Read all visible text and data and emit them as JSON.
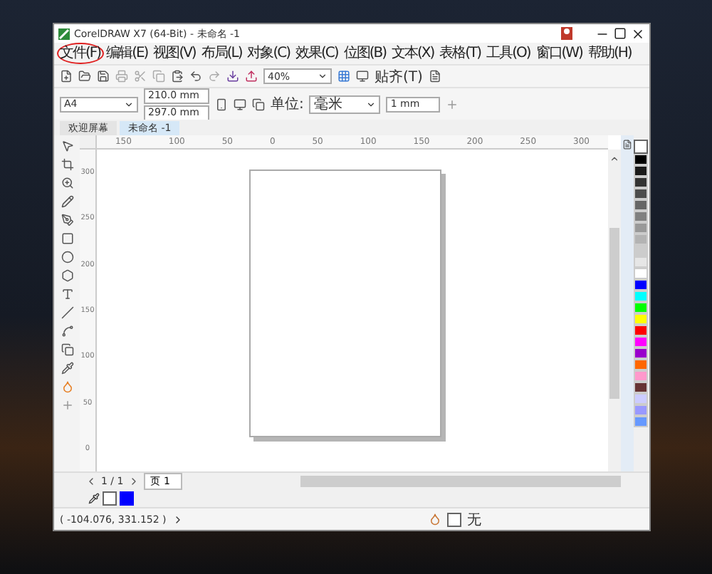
{
  "window": {
    "title": "CorelDRAW X7 (64-Bit) - 未命名 -1"
  },
  "menu": [
    {
      "label": "文件(F)",
      "circled": true
    },
    {
      "label": "编辑(E)",
      "circled": false
    },
    {
      "label": "视图(V)",
      "circled": false
    },
    {
      "label": "布局(L)",
      "circled": false
    },
    {
      "label": "对象(C)",
      "circled": false
    },
    {
      "label": "效果(C)",
      "circled": false
    },
    {
      "label": "位图(B)",
      "circled": false
    },
    {
      "label": "文本(X)",
      "circled": false
    },
    {
      "label": "表格(T)",
      "circled": false
    },
    {
      "label": "工具(O)",
      "circled": false
    },
    {
      "label": "窗口(W)",
      "circled": false
    },
    {
      "label": "帮助(H)",
      "circled": false
    }
  ],
  "toolbar": {
    "zoom": "40%",
    "snap": "贴齐(T)"
  },
  "property_bar": {
    "page_size": "A4",
    "width": "210.0 mm",
    "height": "297.0 mm",
    "units_label": "单位:",
    "units": "毫米",
    "nudge": "1 mm"
  },
  "doc_tabs": [
    {
      "label": "欢迎屏幕",
      "selected": false
    },
    {
      "label": "未命名 -1",
      "selected": true
    }
  ],
  "rulers": {
    "horizontal": [
      "150",
      "100",
      "50",
      "0",
      "50",
      "100",
      "150",
      "200",
      "250",
      "300"
    ],
    "vertical": [
      "300",
      "250",
      "200",
      "150",
      "100",
      "50",
      "0"
    ]
  },
  "page_nav": {
    "count": "1 / 1",
    "page_tab": "页 1"
  },
  "palette": [
    {
      "color": "#000000"
    },
    {
      "color": "#1a1a1a"
    },
    {
      "color": "#333333"
    },
    {
      "color": "#4d4d4d"
    },
    {
      "color": "#666666"
    },
    {
      "color": "#808080"
    },
    {
      "color": "#999999"
    },
    {
      "color": "#b3b3b3"
    },
    {
      "color": "#cccccc"
    },
    {
      "color": "#e6e6e6"
    },
    {
      "color": "#ffffff"
    },
    {
      "color": "#0000ff"
    },
    {
      "color": "#00ffff"
    },
    {
      "color": "#00ff00"
    },
    {
      "color": "#ffff00"
    },
    {
      "color": "#ff0000"
    },
    {
      "color": "#ff00ff"
    },
    {
      "color": "#9900cc"
    },
    {
      "color": "#ff6600"
    },
    {
      "color": "#ff99cc"
    },
    {
      "color": "#663333"
    },
    {
      "color": "#ccccff"
    },
    {
      "color": "#9999ff"
    },
    {
      "color": "#6699ff"
    }
  ],
  "document_colors": [
    {
      "color": "#0000ff"
    }
  ],
  "status": {
    "coords": "( -104.076, 331.152 )",
    "fill": "无"
  }
}
